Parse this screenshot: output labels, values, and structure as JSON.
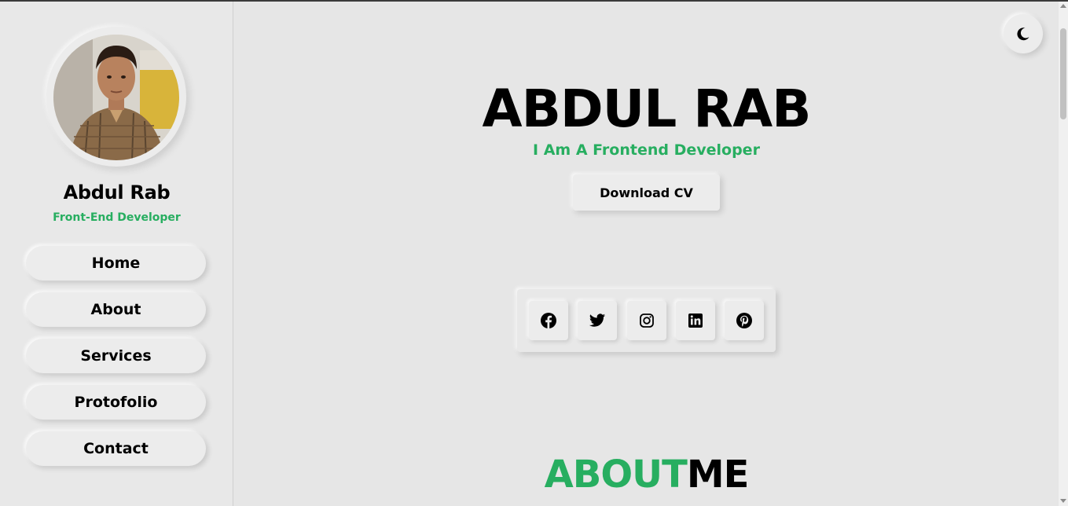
{
  "sidebar": {
    "profile": {
      "name": "Abdul Rab",
      "role": "Front-End Developer"
    },
    "nav": [
      {
        "label": "Home"
      },
      {
        "label": "About"
      },
      {
        "label": "Services"
      },
      {
        "label": "Protofolio"
      },
      {
        "label": "Contact"
      }
    ]
  },
  "hero": {
    "name": "ABDUL RAB",
    "subtitle": "I Am A Frontend Developer",
    "cv_button": "Download CV"
  },
  "social": [
    {
      "icon": "facebook-icon"
    },
    {
      "icon": "twitter-icon"
    },
    {
      "icon": "instagram-icon"
    },
    {
      "icon": "linkedin-icon"
    },
    {
      "icon": "pinterest-icon"
    }
  ],
  "theme_toggle": {
    "icon": "moon-icon"
  },
  "about": {
    "heading_accent": "ABOUT",
    "heading_rest": "ME"
  },
  "colors": {
    "accent": "#27ae60",
    "background": "#e6e6e6",
    "text": "#000000"
  }
}
